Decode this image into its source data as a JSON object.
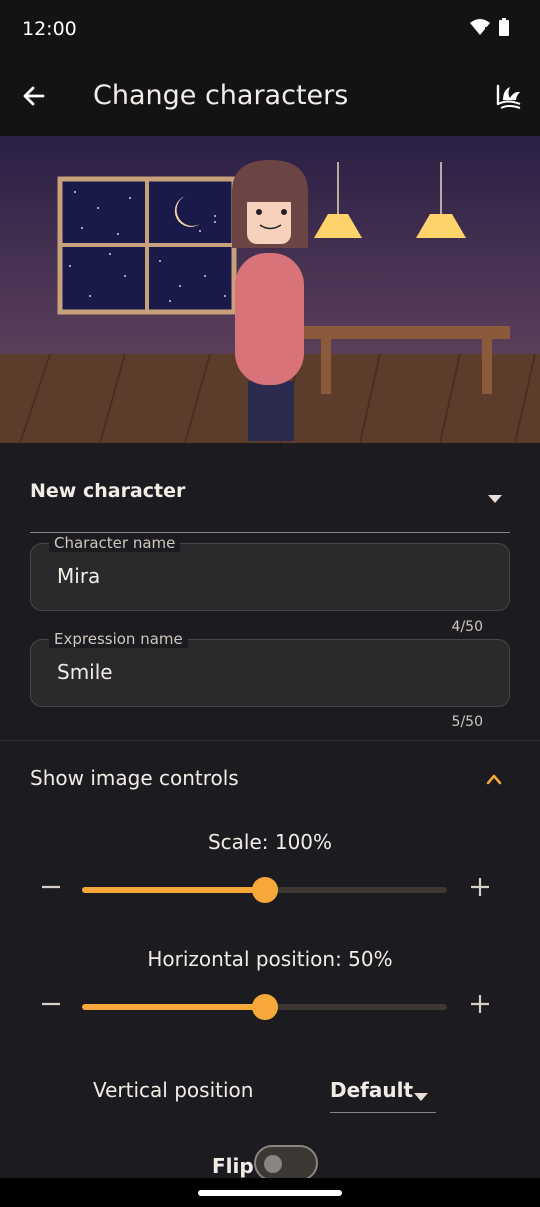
{
  "status_bar": {
    "time": "12:00"
  },
  "app_bar": {
    "title": "Change characters"
  },
  "character_select": {
    "selected": "New character"
  },
  "fields": {
    "character_name": {
      "label": "Character name",
      "value": "Mira",
      "counter": "4/50"
    },
    "expression_name": {
      "label": "Expression name",
      "value": "Smile",
      "counter": "5/50"
    }
  },
  "image_controls": {
    "toggle_label": "Show image controls",
    "scale": {
      "label": "Scale: 100%",
      "value_fraction": 0.5
    },
    "horizontal": {
      "label": "Horizontal position: 50%",
      "value_fraction": 0.5
    },
    "vertical": {
      "label": "Vertical position",
      "value": "Default"
    },
    "flip": {
      "label": "Flip",
      "on": false
    }
  },
  "colors": {
    "accent": "#f7a83a",
    "background": "#1c1b1f",
    "app_bar": "#131316"
  },
  "icons": [
    "wifi-icon",
    "battery-icon",
    "back-arrow-icon",
    "scene-icon",
    "dropdown-arrow-icon",
    "chevron-up-icon",
    "minus-icon",
    "plus-icon"
  ]
}
